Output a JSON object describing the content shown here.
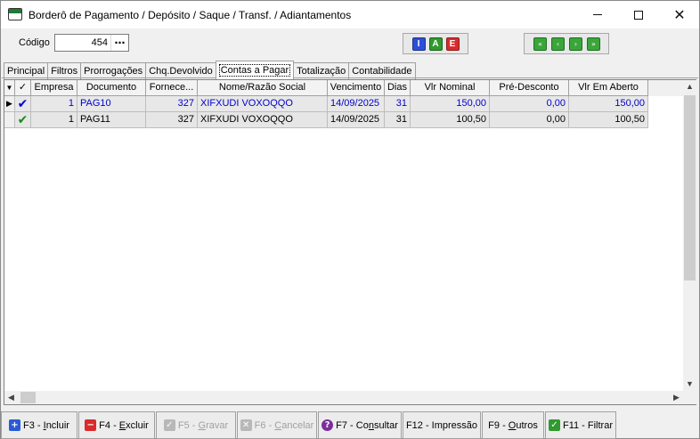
{
  "window": {
    "title": "Borderô de Pagamento / Depósito / Saque / Transf. / Adiantamentos",
    "minimize_glyph": "",
    "maximize_glyph": "",
    "close_glyph": "✕"
  },
  "codigo": {
    "label": "Código",
    "value": "454",
    "lookup_label": "⋯"
  },
  "iae_buttons": [
    {
      "label": "I",
      "color": "#2b4fd6"
    },
    {
      "label": "A",
      "color": "#2f9a2f"
    },
    {
      "label": "E",
      "color": "#d92b2b"
    }
  ],
  "nav_buttons": [
    {
      "icon": "first-record-icon",
      "glyph": "«"
    },
    {
      "icon": "previous-record-icon",
      "glyph": "‹"
    },
    {
      "icon": "next-record-icon",
      "glyph": "›"
    },
    {
      "icon": "last-record-icon",
      "glyph": "»"
    }
  ],
  "tabs": [
    {
      "label": "Principal",
      "active": false
    },
    {
      "label": "Filtros",
      "active": false
    },
    {
      "label": "Prorrogações",
      "active": false
    },
    {
      "label": "Chq.Devolvido",
      "active": false
    },
    {
      "label": "Contas a Pagar",
      "active": true
    },
    {
      "label": "Totalização",
      "active": false
    },
    {
      "label": "Contabilidade",
      "active": false
    }
  ],
  "grid": {
    "columns": [
      "",
      "✓",
      "Empresa",
      "Documento",
      "Fornece...",
      "Nome/Razão Social",
      "Vencimento",
      "Dias",
      "Vlr Nominal",
      "Pré-Desconto",
      "Vlr Em Aberto"
    ],
    "rows": [
      {
        "indicator": "▶",
        "checked": "✔",
        "empresa": "1",
        "documento": "PAG10",
        "fornecedor": "327",
        "nome": "XIFXUDI VOXOQQO",
        "vencimento": "14/09/2025",
        "dias": "31",
        "vlr_nominal": "150,00",
        "pre_desconto": "0,00",
        "vlr_aberto": "150,00"
      },
      {
        "indicator": "",
        "checked": "✔",
        "empresa": "1",
        "documento": "PAG11",
        "fornecedor": "327",
        "nome": "XIFXUDI VOXOQQO",
        "vencimento": "14/09/2025",
        "dias": "31",
        "vlr_nominal": "100,50",
        "pre_desconto": "0,00",
        "vlr_aberto": "100,50"
      }
    ]
  },
  "function_keys": [
    {
      "key": "F3",
      "label": "Incluir",
      "accel": "I",
      "icon": "plus-icon",
      "icon_color": "#2b5ad6",
      "glyph": "+",
      "disabled": false
    },
    {
      "key": "F4",
      "label": "Excluir",
      "accel": "E",
      "icon": "minus-icon",
      "icon_color": "#d92b2b",
      "glyph": "−",
      "disabled": false
    },
    {
      "key": "F5",
      "label": "Gravar",
      "accel": "G",
      "icon": "save-check-icon",
      "icon_color": "#b8b8b8",
      "glyph": "✓",
      "disabled": true
    },
    {
      "key": "F6",
      "label": "Cancelar",
      "accel": "C",
      "icon": "cancel-x-icon",
      "icon_color": "#b8b8b8",
      "glyph": "✕",
      "disabled": true
    },
    {
      "key": "F7",
      "label": "Consultar",
      "accel": "n",
      "icon": "help-question-icon",
      "icon_color": "#7b2d9c",
      "glyph": "?",
      "disabled": false
    },
    {
      "key": "F12",
      "label": "Impressão",
      "accel": "",
      "icon": "",
      "icon_color": "",
      "glyph": "",
      "disabled": false
    },
    {
      "key": "F9",
      "label": "Outros",
      "accel": "O",
      "icon": "",
      "icon_color": "",
      "glyph": "",
      "disabled": false
    },
    {
      "key": "F11",
      "label": "Filtrar",
      "accel": "",
      "icon": "filter-check-icon",
      "icon_color": "#2f9a2f",
      "glyph": "✓",
      "disabled": false
    }
  ]
}
